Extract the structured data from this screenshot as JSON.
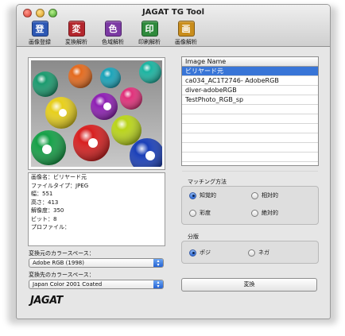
{
  "window": {
    "title": "JAGAT TG Tool"
  },
  "toolbar": [
    {
      "glyph": "登",
      "label": "画像登録",
      "color": "#2d58b4"
    },
    {
      "glyph": "変",
      "label": "変換解析",
      "color": "#b3262d"
    },
    {
      "glyph": "色",
      "label": "色域解析",
      "color": "#7b3aa3"
    },
    {
      "glyph": "印",
      "label": "印刷解析",
      "color": "#2f8a3c"
    },
    {
      "glyph": "画",
      "label": "画像解析",
      "color": "#c98d1c"
    }
  ],
  "image_info": [
    "画像名：ビリヤード元",
    "ファイルタイプ：JPEG",
    "幅：551",
    "高さ：413",
    "解像度：350",
    "ビット：8",
    "プロファイル："
  ],
  "source_space": {
    "label": "変換元のカラースペース：",
    "value": "Adobe RGB (1998)"
  },
  "dest_space": {
    "label": "変換先のカラースペース：",
    "value": "Japan Color 2001 Coated"
  },
  "logo": "JAGAT",
  "image_list": {
    "header": "Image Name",
    "items": [
      "ビリヤード元",
      "ca034_AC1T2746- AdobeRGB",
      "diver-adobeRGB",
      "TestPhoto_RGB_sp",
      "",
      "",
      "",
      "",
      "",
      "",
      ""
    ],
    "selected_index": 0
  },
  "matching": {
    "title": "マッチング方法",
    "options": [
      "知覚的",
      "相対的",
      "彩度",
      "絶対的"
    ],
    "selected": "知覚的"
  },
  "separation": {
    "title": "分版",
    "options": [
      "ポジ",
      "ネガ"
    ],
    "selected": "ポジ"
  },
  "convert_button": "変換"
}
